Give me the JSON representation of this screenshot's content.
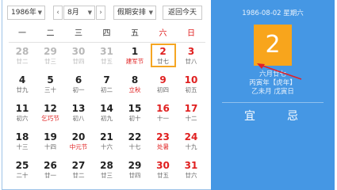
{
  "toolbar": {
    "year_value": "1986年",
    "month_value": "8月",
    "holiday_label": "假期安排",
    "today_button": "返回今天"
  },
  "weekdays": [
    "一",
    "二",
    "三",
    "四",
    "五",
    "六",
    "日"
  ],
  "weeks": [
    [
      {
        "day": "28",
        "lunar": "廿二",
        "other": true
      },
      {
        "day": "29",
        "lunar": "廿三",
        "other": true
      },
      {
        "day": "30",
        "lunar": "廿四",
        "other": true
      },
      {
        "day": "31",
        "lunar": "廿五",
        "other": true
      },
      {
        "day": "1",
        "lunar": "建军节",
        "fest": true
      },
      {
        "day": "2",
        "lunar": "廿七",
        "selected": true
      },
      {
        "day": "3",
        "lunar": "廿八"
      }
    ],
    [
      {
        "day": "4",
        "lunar": "廿九"
      },
      {
        "day": "5",
        "lunar": "三十"
      },
      {
        "day": "6",
        "lunar": "初一"
      },
      {
        "day": "7",
        "lunar": "初二"
      },
      {
        "day": "8",
        "lunar": "立秋",
        "fest": true
      },
      {
        "day": "9",
        "lunar": "初四"
      },
      {
        "day": "10",
        "lunar": "初五"
      }
    ],
    [
      {
        "day": "11",
        "lunar": "初六"
      },
      {
        "day": "12",
        "lunar": "乞巧节",
        "fest": true
      },
      {
        "day": "13",
        "lunar": "初八"
      },
      {
        "day": "14",
        "lunar": "初九"
      },
      {
        "day": "15",
        "lunar": "初十"
      },
      {
        "day": "16",
        "lunar": "十一"
      },
      {
        "day": "17",
        "lunar": "十二"
      }
    ],
    [
      {
        "day": "18",
        "lunar": "十三"
      },
      {
        "day": "19",
        "lunar": "十四"
      },
      {
        "day": "20",
        "lunar": "中元节",
        "fest": true
      },
      {
        "day": "21",
        "lunar": "十六"
      },
      {
        "day": "22",
        "lunar": "十七"
      },
      {
        "day": "23",
        "lunar": "处暑",
        "fest": true
      },
      {
        "day": "24",
        "lunar": "十九"
      }
    ],
    [
      {
        "day": "25",
        "lunar": "二十"
      },
      {
        "day": "26",
        "lunar": "廿一"
      },
      {
        "day": "27",
        "lunar": "廿二"
      },
      {
        "day": "28",
        "lunar": "廿三"
      },
      {
        "day": "29",
        "lunar": "廿四"
      },
      {
        "day": "30",
        "lunar": "廿五"
      },
      {
        "day": "31",
        "lunar": "廿六"
      }
    ]
  ],
  "side": {
    "date_line": "1986-08-02 星期六",
    "big_day": "2",
    "lunar_date": "六月廿七",
    "ganzhi_year": "丙寅年【虎年】",
    "ganzhi_month_day": "乙未月 戊寅日",
    "yi": "宜",
    "ji": "忌"
  },
  "colors": {
    "panel": "#4597e4",
    "highlight": "#f8a51c",
    "weekend": "#e02020",
    "annotation": "#e0202a"
  }
}
